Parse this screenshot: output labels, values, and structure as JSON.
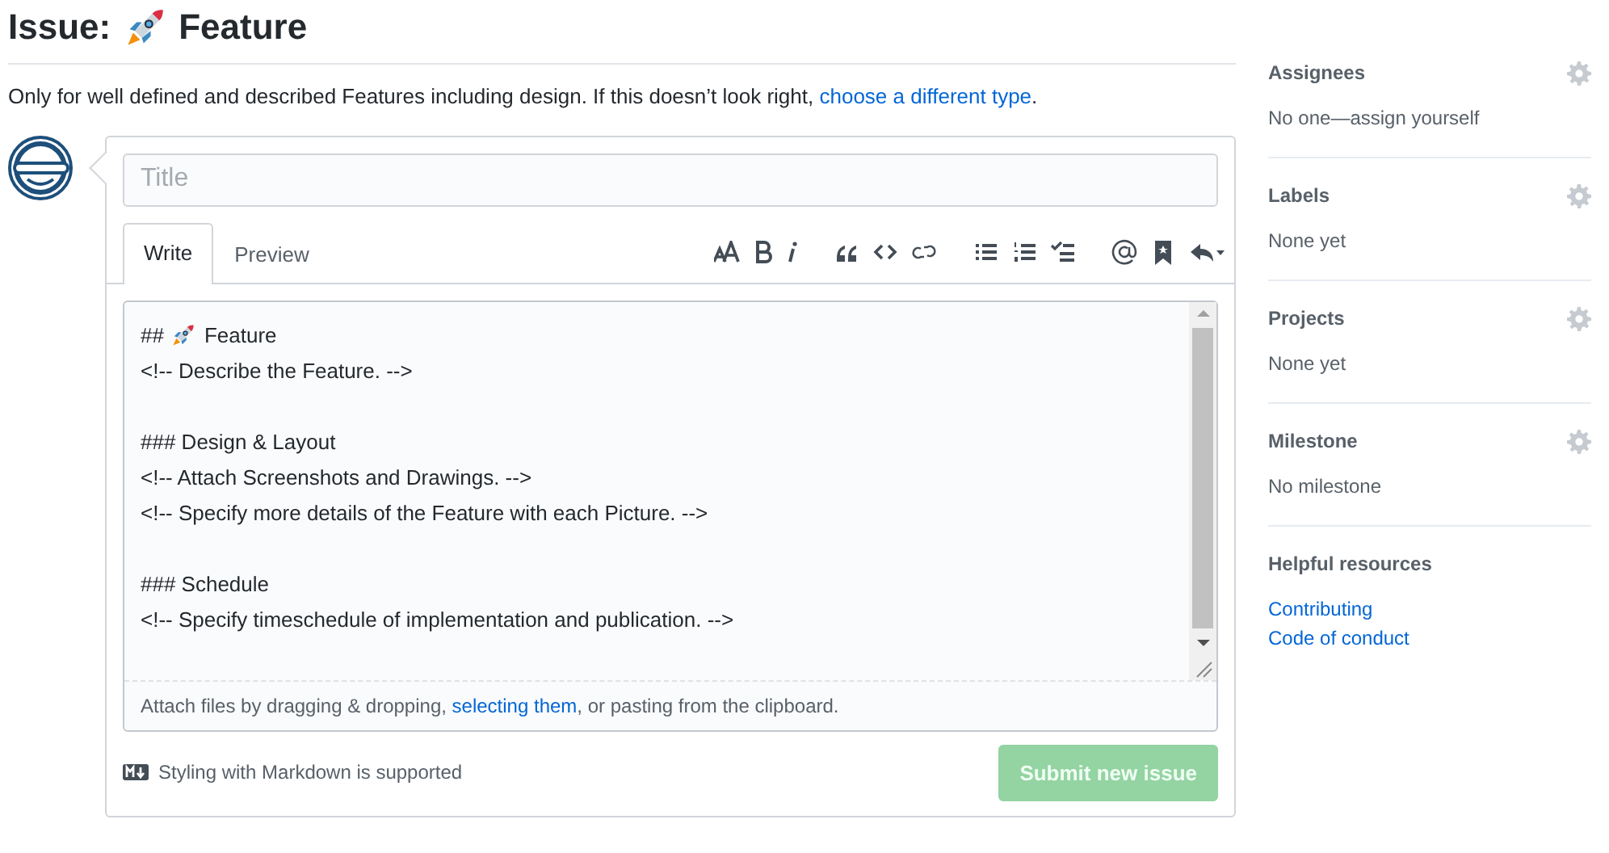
{
  "heading": {
    "prefix": "Issue:",
    "name": "Feature"
  },
  "description": {
    "text": "Only for well defined and described Features including design. If this doesn’t look right, ",
    "link": "choose a different type",
    "end": "."
  },
  "title_field": {
    "placeholder": "Title"
  },
  "tabs": [
    {
      "label": "Write",
      "selected": true
    },
    {
      "label": "Preview",
      "selected": false
    }
  ],
  "toolbar": [
    [
      {
        "kind": "header"
      },
      {
        "kind": "bold"
      },
      {
        "kind": "italic"
      }
    ],
    [
      {
        "kind": "quote"
      },
      {
        "kind": "code"
      },
      {
        "kind": "link"
      }
    ],
    [
      {
        "kind": "bullet-list"
      },
      {
        "kind": "numbered-list"
      },
      {
        "kind": "task-list"
      }
    ],
    [
      {
        "kind": "mention"
      },
      {
        "kind": "saved-reply"
      },
      {
        "kind": "reply"
      }
    ]
  ],
  "editor_lines": [
    {
      "kind": "heading-rocket",
      "text": "##",
      "after": "Feature"
    },
    {
      "kind": "text",
      "text": "<!-- Describe the Feature. -->"
    },
    {
      "kind": "blank"
    },
    {
      "kind": "text",
      "text": "### Design & Layout"
    },
    {
      "kind": "text",
      "text": "<!-- Attach Screenshots and Drawings. -->"
    },
    {
      "kind": "text",
      "text": "<!-- Specify more details of the Feature with each Picture. -->"
    },
    {
      "kind": "blank"
    },
    {
      "kind": "text",
      "text": "### Schedule"
    },
    {
      "kind": "text",
      "text": "<!-- Specify timeschedule of implementation and publication. -->"
    }
  ],
  "attach_hint": {
    "before": "Attach files by dragging & dropping, ",
    "link": "selecting them",
    "after": ", or pasting from the clipboard."
  },
  "markdown_note": "Styling with Markdown is supported",
  "submit_button": {
    "label": "Submit new issue",
    "disabled": true
  },
  "sidebar": [
    {
      "title": "Assignees",
      "value": "No one—assign yourself",
      "settings": true
    },
    {
      "title": "Labels",
      "value": "None yet",
      "settings": true
    },
    {
      "title": "Projects",
      "value": "None yet",
      "settings": true
    },
    {
      "title": "Milestone",
      "value": "No milestone",
      "settings": true
    },
    {
      "title": "Helpful resources",
      "links": [
        "Contributing",
        "Code of conduct"
      ],
      "settings": false
    }
  ]
}
